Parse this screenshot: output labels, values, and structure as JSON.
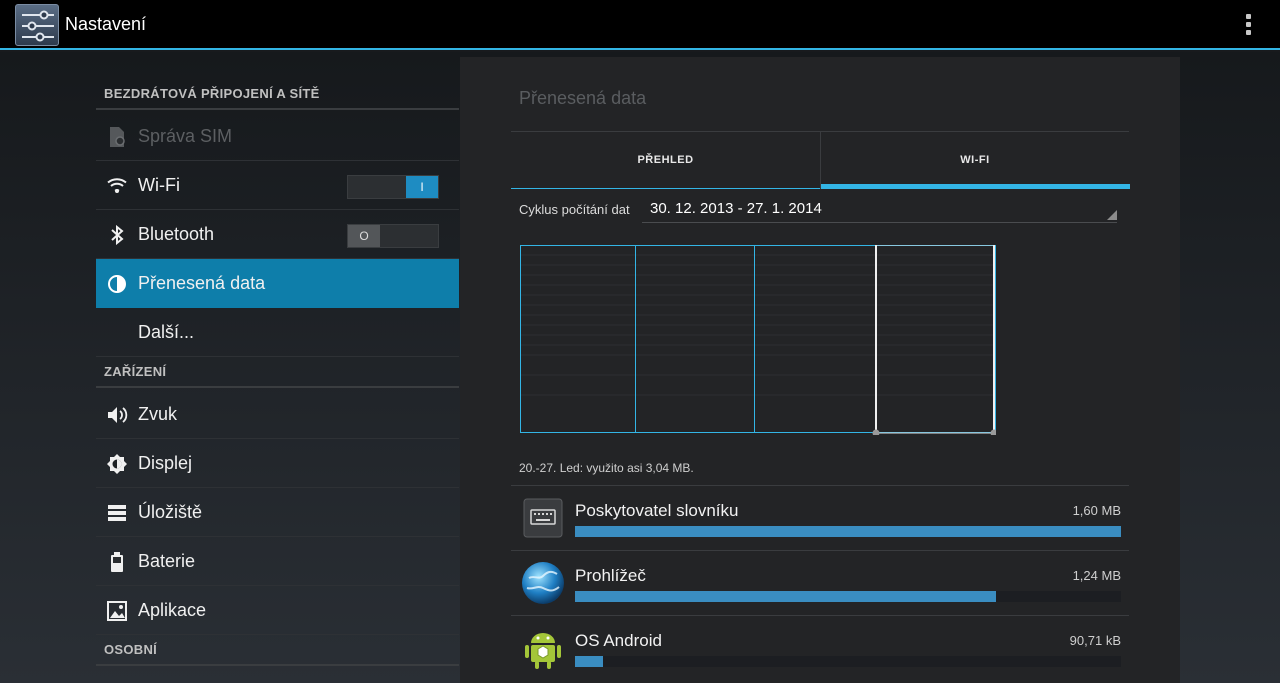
{
  "actionbar": {
    "title": "Nastavení",
    "app_icon": "settings-sliders-icon",
    "overflow_icon": "overflow-menu-icon"
  },
  "sidebar": {
    "sections": [
      {
        "header": "BEZDRÁTOVÁ PŘIPOJENÍ A SÍTĚ"
      },
      {
        "header": "ZAŘÍZENÍ"
      },
      {
        "header": "OSOBNÍ"
      }
    ],
    "items": [
      {
        "label": "Správa SIM",
        "icon": "sim-card-icon",
        "disabled": true
      },
      {
        "label": "Wi-Fi",
        "icon": "wifi-icon",
        "toggle": "I",
        "toggle_state": "on"
      },
      {
        "label": "Bluetooth",
        "icon": "bluetooth-icon",
        "toggle": "O",
        "toggle_state": "off"
      },
      {
        "label": "Přenesená data",
        "icon": "data-usage-icon",
        "selected": true
      },
      {
        "label": "Další...",
        "icon": ""
      },
      {
        "label": "Zvuk",
        "icon": "speaker-icon"
      },
      {
        "label": "Displej",
        "icon": "brightness-icon"
      },
      {
        "label": "Úložiště",
        "icon": "storage-icon"
      },
      {
        "label": "Baterie",
        "icon": "battery-icon"
      },
      {
        "label": "Aplikace",
        "icon": "apps-icon"
      }
    ]
  },
  "panel": {
    "title": "Přenesená data",
    "tabs": [
      {
        "label": "PŘEHLED"
      },
      {
        "label": "WI-FI",
        "selected": true
      }
    ],
    "cycle_label": "Cyklus počítání dat",
    "cycle_value": "30. 12. 2013 - 27. 1. 2014",
    "summary": "20.-27. Led: využito asi 3,04 MB.",
    "apps": [
      {
        "name": "Poskytovatel slovníku",
        "size": "1,60 MB",
        "fraction": 1.0,
        "icon": "keyboard-icon"
      },
      {
        "name": "Prohlížeč",
        "size": "1,24 MB",
        "fraction": 0.771,
        "icon": "globe-icon"
      },
      {
        "name": "OS Android",
        "size": "90,71 kB",
        "fraction": 0.051,
        "icon": "android-icon"
      }
    ]
  },
  "colors": {
    "accent": "#33b5e5",
    "selected_bg": "#0e7eaa",
    "bar": "#3a8dc1"
  }
}
